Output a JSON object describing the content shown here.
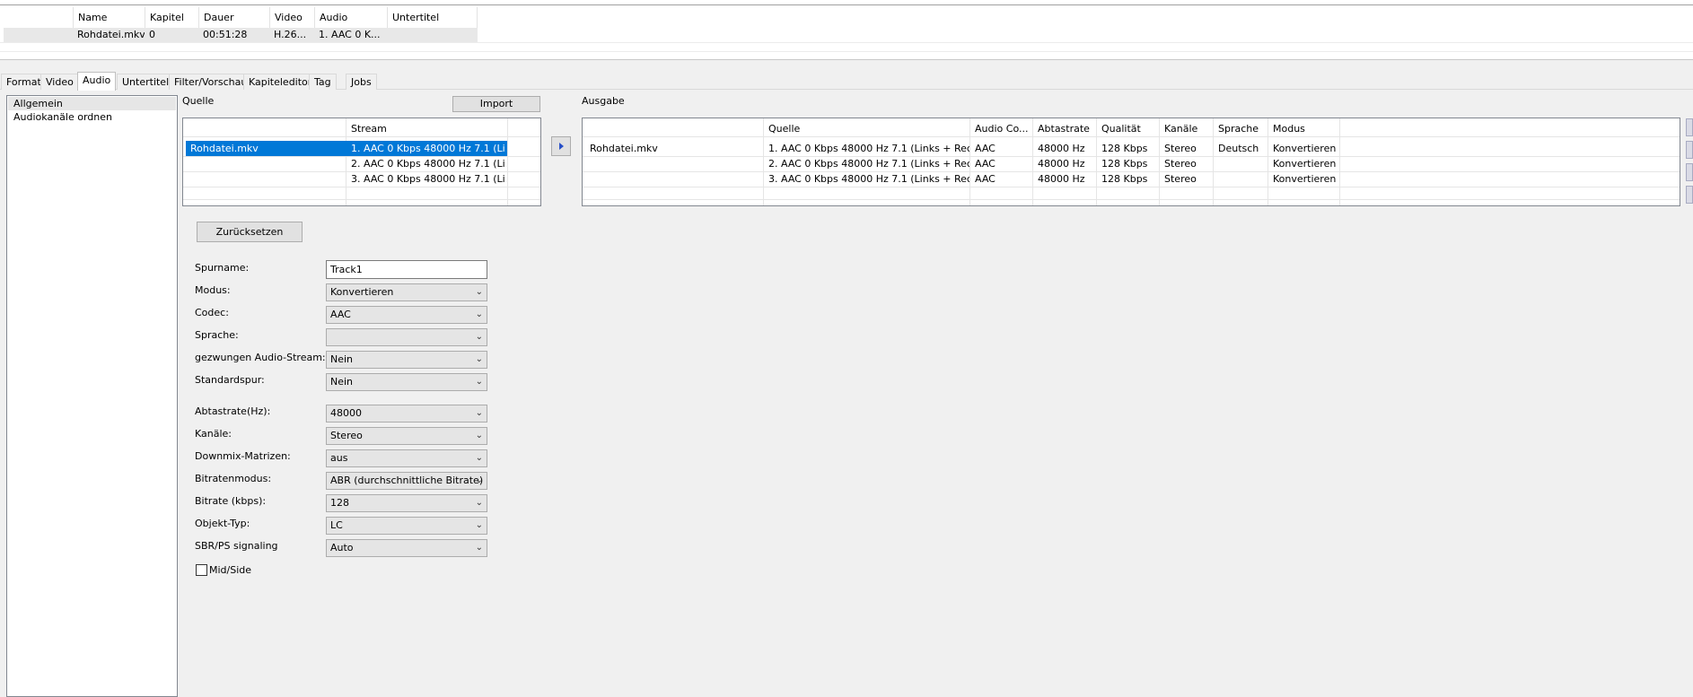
{
  "file_table": {
    "columns": [
      "Name",
      "Kapitel",
      "Dauer",
      "Video",
      "Audio",
      "Untertitel"
    ],
    "row": {
      "name": "Rohdatei.mkv",
      "kapitel": "0",
      "dauer": "00:51:28",
      "video": "H.26...",
      "audio": "1. AAC 0 K...",
      "untertitel": ""
    }
  },
  "tabs": [
    "Format",
    "Video",
    "Audio",
    "Untertitel",
    "Filter/Vorschau",
    "Kapiteleditor",
    "Tag",
    "Jobs"
  ],
  "active_tab": "Audio",
  "left_nav": [
    "Allgemein",
    "Audiokanäle ordnen"
  ],
  "source": {
    "title": "Quelle",
    "import_label": "Import",
    "stream_header": "Stream",
    "rows": [
      {
        "file": "Rohdatei.mkv",
        "stream": "1. AAC  0 Kbps 48000 Hz 7.1 (Li..."
      },
      {
        "file": "",
        "stream": "2. AAC  0 Kbps 48000 Hz 7.1 (Li..."
      },
      {
        "file": "",
        "stream": "3. AAC  0 Kbps 48000 Hz 7.1 (Li..."
      }
    ]
  },
  "output": {
    "title": "Ausgabe",
    "headers": [
      "Quelle",
      "Audio Co...",
      "Abtastrate",
      "Qualität",
      "Kanäle",
      "Sprache",
      "Modus"
    ],
    "rows": [
      {
        "file": "Rohdatei.mkv",
        "quelle": "1. AAC  0 Kbps 48000 Hz 7.1 (Links + Rec...",
        "codec": "AAC",
        "rate": "48000 Hz",
        "quality": "128 Kbps",
        "channels": "Stereo",
        "language": "Deutsch",
        "mode": "Konvertieren"
      },
      {
        "file": "",
        "quelle": "2. AAC  0 Kbps 48000 Hz 7.1 (Links + Rec...",
        "codec": "AAC",
        "rate": "48000 Hz",
        "quality": "128 Kbps",
        "channels": "Stereo",
        "language": "",
        "mode": "Konvertieren"
      },
      {
        "file": "",
        "quelle": "3. AAC  0 Kbps 48000 Hz 7.1 (Links + Rec...",
        "codec": "AAC",
        "rate": "48000 Hz",
        "quality": "128 Kbps",
        "channels": "Stereo",
        "language": "",
        "mode": "Konvertieren"
      }
    ]
  },
  "reset_label": "Zurücksetzen",
  "form": {
    "spurname_label": "Spurname:",
    "spurname_value": "Track1",
    "modus_label": "Modus:",
    "modus_value": "Konvertieren",
    "codec_label": "Codec:",
    "codec_value": "AAC",
    "sprache_label": "Sprache:",
    "sprache_value": "",
    "forced_label": "gezwungen Audio-Stream:",
    "forced_value": "Nein",
    "default_label": "Standardspur:",
    "default_value": "Nein",
    "rate_label": "Abtastrate(Hz):",
    "rate_value": "48000",
    "channels_label": "Kanäle:",
    "channels_value": "Stereo",
    "downmix_label": "Downmix-Matrizen:",
    "downmix_value": "aus",
    "bitmode_label": "Bitratenmodus:",
    "bitmode_value": "ABR (durchschnittliche Bitrate)",
    "bitrate_label": "Bitrate (kbps):",
    "bitrate_value": "128",
    "objtype_label": "Objekt-Typ:",
    "objtype_value": "LC",
    "sbr_label": "SBR/PS signaling",
    "sbr_value": "Auto",
    "midside_label": "Mid/Side",
    "midside_checked": false
  }
}
